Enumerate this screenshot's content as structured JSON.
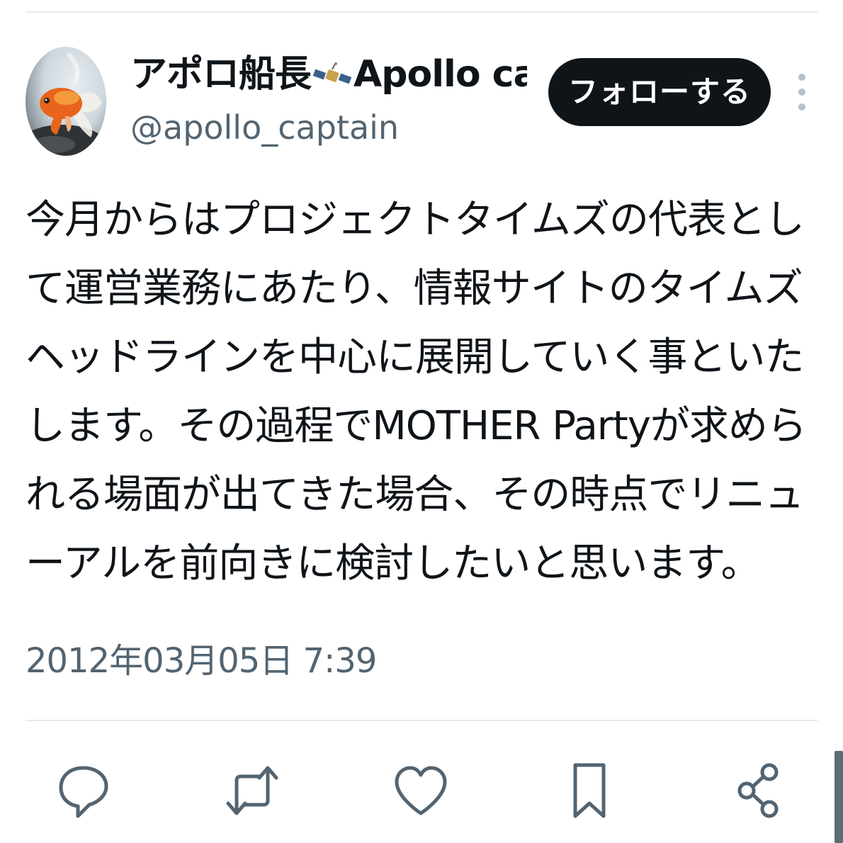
{
  "author": {
    "display_name_prefix": "アポロ船長",
    "display_name_suffix": "Apollo cap...",
    "handle": "@apollo_captain",
    "avatar_icon": "goldfish-avatar",
    "name_emoji_icon": "satellite-icon"
  },
  "follow_button": {
    "label": "フォローする"
  },
  "more_button": {
    "icon": "more-vertical-icon"
  },
  "tweet": {
    "lines": [
      "今月からはプロジェクトタイムズの代表とし",
      "て運営業務にあたり、情報サイトのタイムズ",
      "ヘッドラインを中心に展開していく事といた",
      "します。その過程でMOTHER Partyが求めら",
      "れる場面が出てきた場合、その時点でリニュ",
      "ーアルを前向きに検討したいと思います。"
    ],
    "timestamp": "2012年03月05日 7:39"
  },
  "actions": [
    {
      "name": "reply",
      "icon": "reply-icon"
    },
    {
      "name": "retweet",
      "icon": "retweet-icon"
    },
    {
      "name": "like",
      "icon": "heart-icon"
    },
    {
      "name": "bookmark",
      "icon": "bookmark-icon"
    },
    {
      "name": "share",
      "icon": "share-icon"
    }
  ],
  "colors": {
    "text_primary": "#0f1419",
    "text_secondary": "#536471",
    "button_bg": "#0f1419",
    "button_text": "#ffffff",
    "divider": "#e6ecf0",
    "icon": "#536471"
  }
}
